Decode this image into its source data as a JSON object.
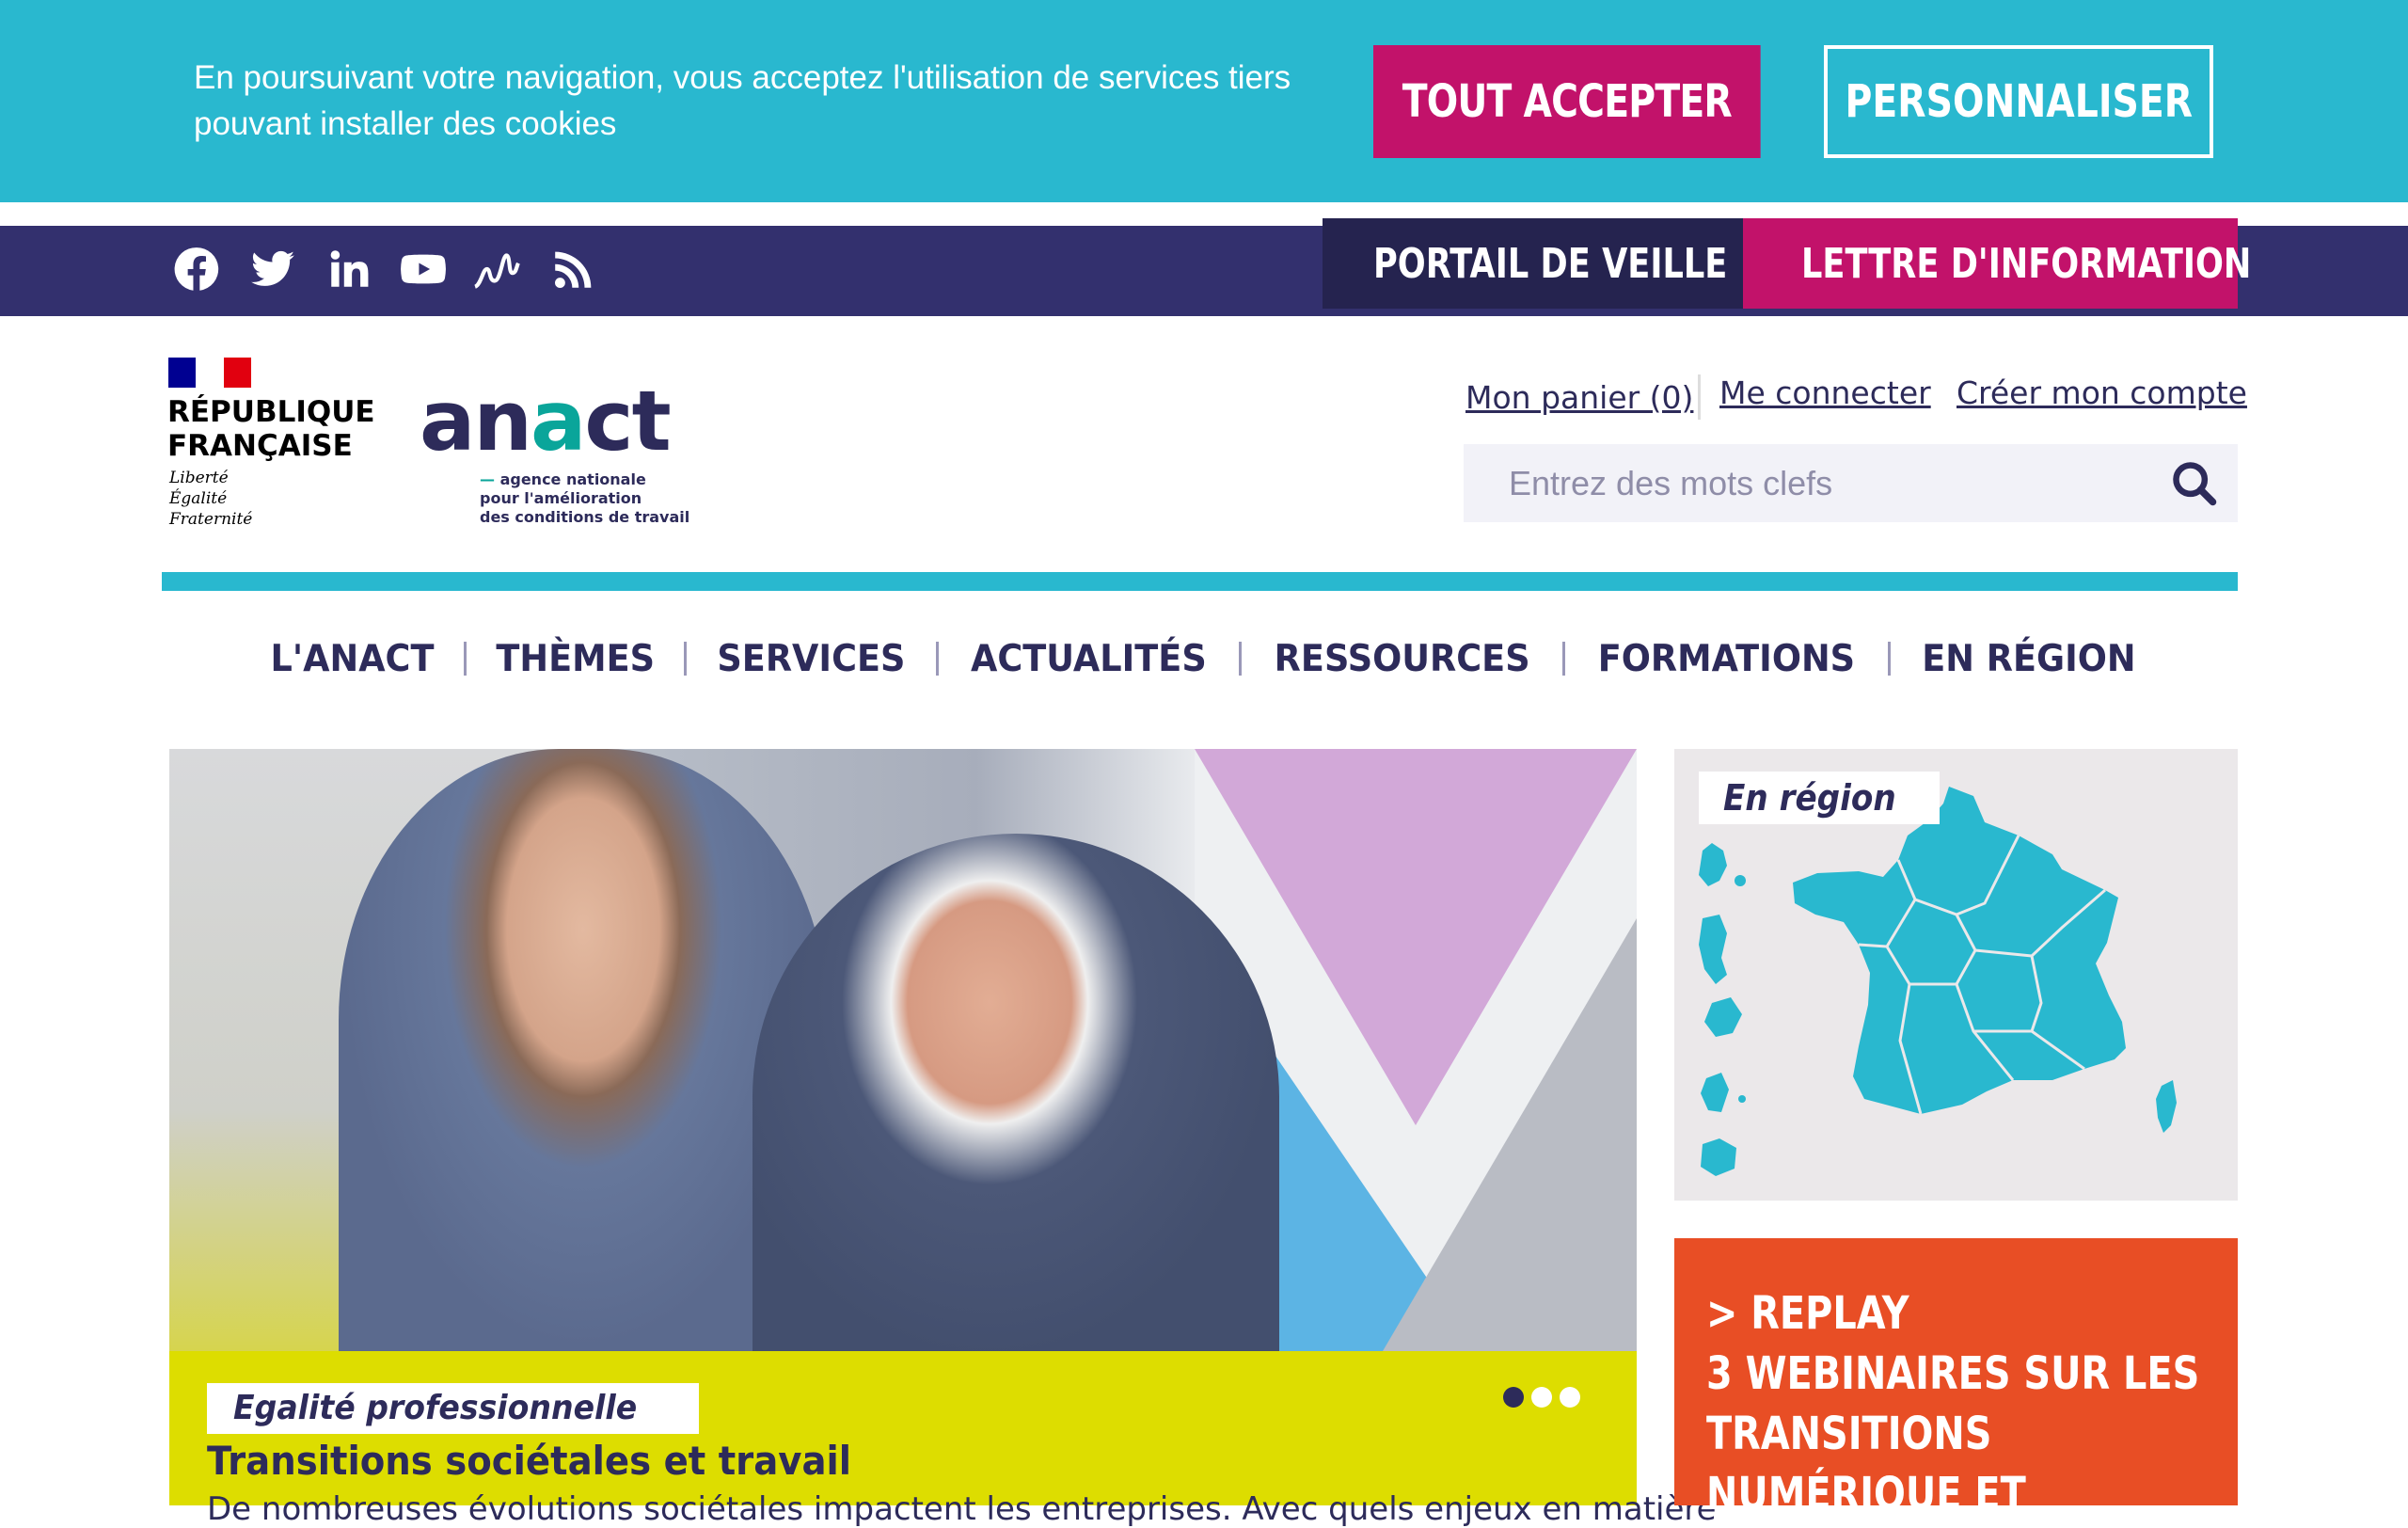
{
  "cookie_banner": {
    "message": "En poursuivant votre navigation, vous acceptez l'utilisation de services tiers pouvant installer des cookies",
    "accept_label": "TOUT ACCEPTER",
    "customize_label": "PERSONNALISER"
  },
  "topbar": {
    "social_icons": [
      "facebook-icon",
      "twitter-icon",
      "linkedin-icon",
      "youtube-icon",
      "veille-icon",
      "rss-icon"
    ],
    "portail_label": "PORTAIL DE VEILLE",
    "lettre_label": "LETTRE D'INFORMATION"
  },
  "header": {
    "republique_line1": "RÉPUBLIQUE",
    "republique_line2": "FRANÇAISE",
    "motto_line1": "Liberté",
    "motto_line2": "Égalité",
    "motto_line3": "Fraternité",
    "anact_logo": "anact",
    "anact_tagline_line1": "agence nationale",
    "anact_tagline_line2": "pour l'amélioration",
    "anact_tagline_line3": "des conditions de travail",
    "cart_label": "Mon panier (0)",
    "login_label": "Me connecter",
    "register_label": "Créer mon compte",
    "search_placeholder": "Entrez des mots clefs"
  },
  "nav": {
    "items": [
      "L'ANACT",
      "THÈMES",
      "SERVICES",
      "ACTUALITÉS",
      "RESSOURCES",
      "FORMATIONS",
      "EN RÉGION"
    ]
  },
  "hero": {
    "tag": "Egalité professionnelle",
    "title": "Transitions sociétales et travail",
    "description": "De nombreuses évolutions sociétales impactent les entreprises. Avec quels enjeux en matière",
    "slide_count": 3,
    "active_slide": 1
  },
  "region_card": {
    "tag": "En région"
  },
  "replay_card": {
    "line1": "> REPLAY",
    "line2": "3 WEBINAIRES SUR LES",
    "line3": "TRANSITIONS",
    "line4": "NUMÉRIQUE ET"
  },
  "colors": {
    "cookie_bg": "#29b8cf",
    "magenta": "#c2126a",
    "navy": "#33306e",
    "text_navy": "#2d2b5a",
    "hero_caption_bg": "#dddd00",
    "replay_bg": "#e84e25"
  }
}
